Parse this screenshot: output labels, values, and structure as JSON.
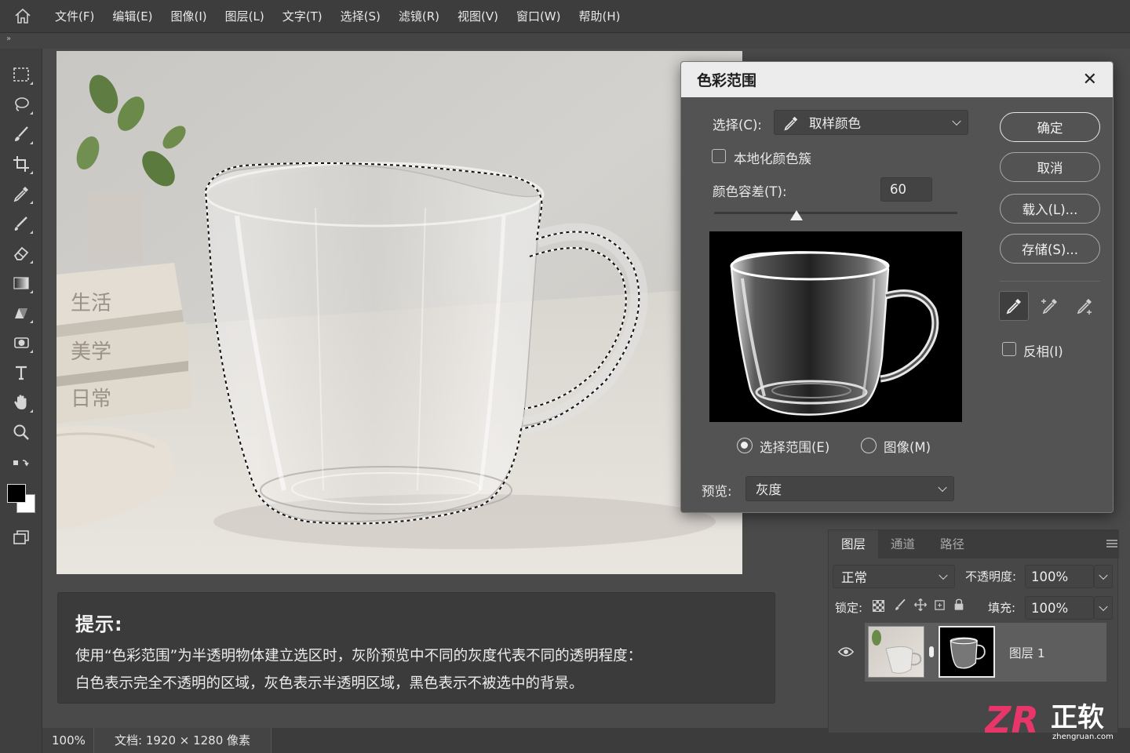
{
  "menu": {
    "items": [
      "文件(F)",
      "编辑(E)",
      "图像(I)",
      "图层(L)",
      "文字(T)",
      "选择(S)",
      "滤镜(R)",
      "视图(V)",
      "窗口(W)",
      "帮助(H)"
    ]
  },
  "subbar": {
    "chevron": "»"
  },
  "tools": [
    "marquee-icon",
    "lasso-icon",
    "brush-icon",
    "crop-icon",
    "eyedropper-icon",
    "healing-brush-icon",
    "eraser-icon",
    "gradient-icon",
    "eraser-block-icon",
    "dodge-icon",
    "type-icon",
    "hand-icon",
    "zoom-icon",
    "swap-colors-icon",
    "color-swatch",
    "screen-mode-icon"
  ],
  "canvas": {
    "book_labels": [
      "生活",
      "美学",
      "日常"
    ]
  },
  "tip": {
    "title": "提示:",
    "line1": "使用“色彩范围”为半透明物体建立选区时，灰阶预览中不同的灰度代表不同的透明程度：",
    "line2": "白色表示完全不透明的区域，灰色表示半透明区域，黑色表示不被选中的背景。"
  },
  "status": {
    "zoom": "100%",
    "doc": "文档: 1920 × 1280 像素"
  },
  "dialog": {
    "title": "色彩范围",
    "close": "✕",
    "select_label": "选择(C):",
    "select_value": "取样颜色",
    "localized_label": "本地化颜色簇",
    "fuzziness_label": "颜色容差(T):",
    "fuzziness_value": "60",
    "fuzziness_level": 0.34,
    "radio_selection": "选择范围(E)",
    "radio_image": "图像(M)",
    "radio_selected": "选择范围(E)",
    "preview_label": "预览:",
    "preview_value": "灰度",
    "buttons": {
      "ok": "确定",
      "cancel": "取消",
      "load": "载入(L)...",
      "save": "存储(S)..."
    },
    "invert_label": "反相(I)"
  },
  "layers": {
    "tabs": [
      "图层",
      "通道",
      "路径"
    ],
    "blend_mode": "正常",
    "opacity_label": "不透明度:",
    "opacity_value": "100%",
    "lock_label": "锁定:",
    "fill_label": "填充:",
    "fill_value": "100%",
    "layer_name": "图层 1"
  },
  "logo": {
    "text": "正软",
    "url": "zhengruan.com",
    "mark": "ZR"
  },
  "colors": {
    "accent_logo": "#e8366a",
    "selection_marquee": "#111111"
  }
}
